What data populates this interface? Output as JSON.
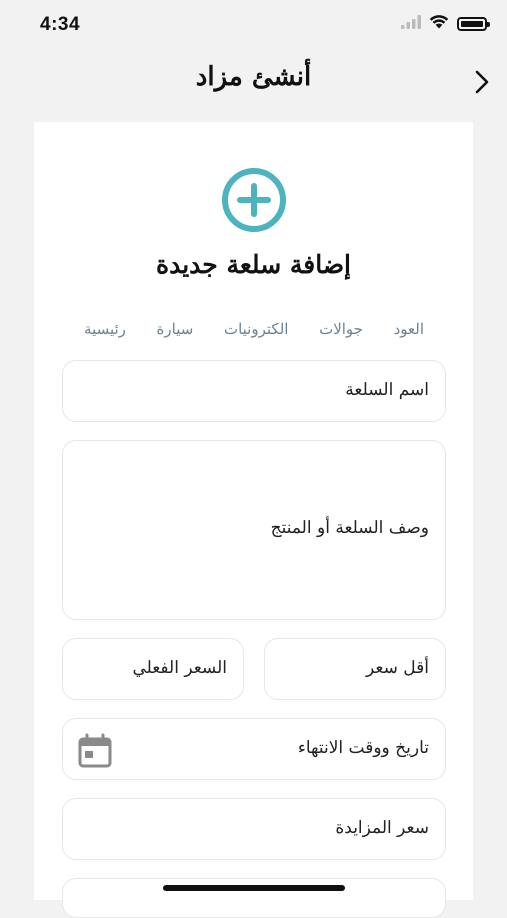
{
  "status_bar": {
    "time": "4:34"
  },
  "header": {
    "title": "أنشئ مزاد"
  },
  "form": {
    "title": "إضافة سلعة جديدة",
    "categories": [
      "رئيسية",
      "سيارة",
      "الكترونيات",
      "جوالات",
      "العود"
    ],
    "item_name_placeholder": "اسم السلعة",
    "description_placeholder": "وصف السلعة أو المنتج",
    "min_price_placeholder": "أقل سعر",
    "actual_price_placeholder": "السعر الفعلي",
    "end_datetime_placeholder": "تاريخ ووقت الانتهاء",
    "bid_price_placeholder": "سعر المزايدة"
  },
  "colors": {
    "accent": "#4cb3bf",
    "category_text": "#6d8392",
    "field_border": "#e6e6e6"
  }
}
